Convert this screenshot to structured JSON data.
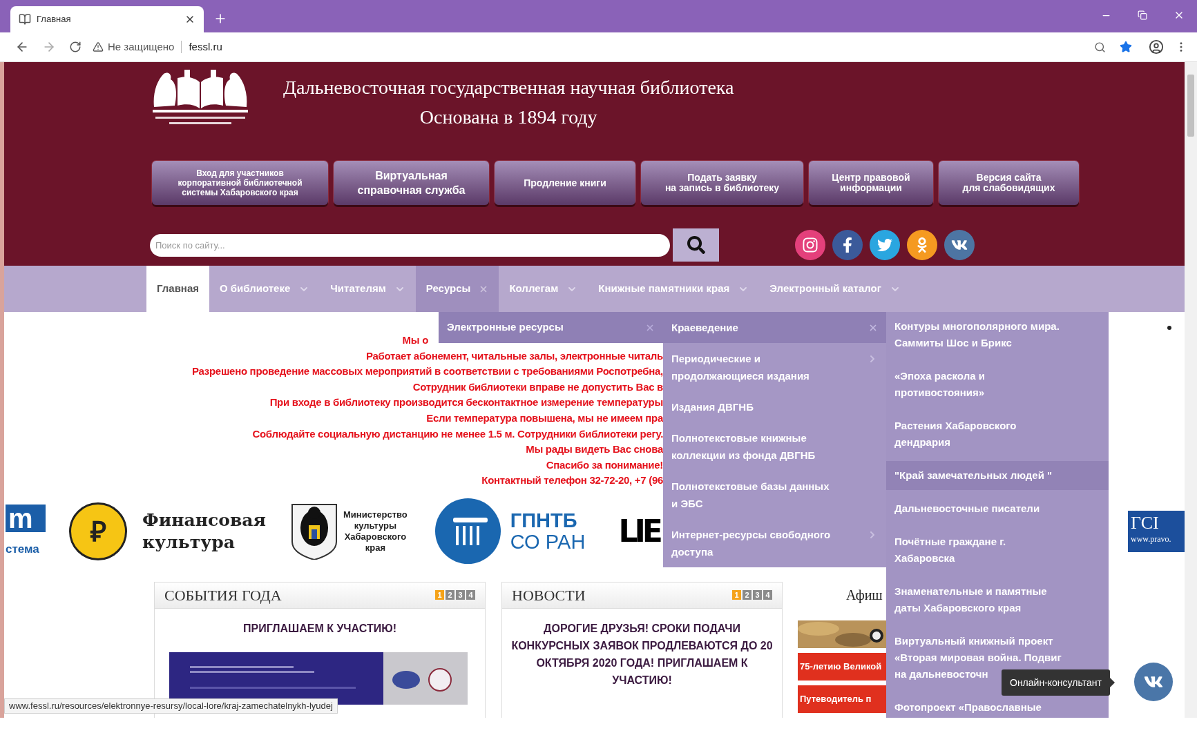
{
  "browser": {
    "tab_title": "Главная",
    "security": "Не защищено",
    "url": "fessl.ru"
  },
  "header": {
    "title": "Дальневосточная государственная научная библиотека",
    "subtitle": "Основана в 1894 году",
    "buttons": [
      [
        "Вход для участников",
        "корпоративной библиотечной",
        "системы Хабаровского края"
      ],
      [
        "Виртуальная",
        "справочная служба"
      ],
      [
        "Продление книги"
      ],
      [
        "Подать заявку",
        "на запись в библиотеку"
      ],
      [
        "Центр правовой",
        "информации"
      ],
      [
        "Версия сайта",
        "для слабовидящих"
      ]
    ]
  },
  "search": {
    "placeholder": "Поиск по сайту..."
  },
  "nav": [
    {
      "label": "Главная",
      "selected": true,
      "expanded": false,
      "has_submenu": false
    },
    {
      "label": "О библиотеке",
      "selected": false,
      "expanded": false,
      "has_submenu": true
    },
    {
      "label": "Читателям",
      "selected": false,
      "expanded": false,
      "has_submenu": true
    },
    {
      "label": "Ресурсы",
      "selected": false,
      "expanded": true,
      "has_submenu": true,
      "children": [
        {
          "label": "Электронные ресурсы",
          "expanded": true,
          "children": [
            {
              "label": "Краеведение",
              "expanded": true,
              "children": [
                {
                  "label": "Контуры многополярного мира. Саммиты Шос и Брикс",
                  "selected": false
                },
                {
                  "label": "«Эпоха раскола и противостояния»",
                  "selected": false
                },
                {
                  "label": "Растения Хабаровского дендрария",
                  "selected": false
                },
                {
                  "label": "\"Край замечательных людей \"",
                  "selected": true
                },
                {
                  "label": "Дальневосточные писатели",
                  "selected": false
                },
                {
                  "label": "Почётные граждане г. Хабаровска",
                  "selected": false
                },
                {
                  "label": "Знаменательные и памятные даты Хабаровского края",
                  "selected": false
                },
                {
                  "label": "Виртуальный книжный проект «Вторая мировая война. Подвиг на дальневосточн",
                  "selected": false
                },
                {
                  "label": "Фотопроект «Православные",
                  "selected": false
                }
              ]
            },
            {
              "label": "Периодические и продолжающиеся издания",
              "expanded": false,
              "has_submenu": true
            },
            {
              "label": "Издания ДВГНБ",
              "expanded": false,
              "has_submenu": false
            },
            {
              "label": "Полнотекстовые книжные коллекции из фонда ДВГНБ",
              "expanded": false,
              "has_submenu": false
            },
            {
              "label": "Полнотекстовые базы данных и ЭБС",
              "expanded": false,
              "has_submenu": false
            },
            {
              "label": "Интернет-ресурсы свободного доступа",
              "expanded": false,
              "has_submenu": true
            }
          ]
        }
      ]
    },
    {
      "label": "Коллегам",
      "selected": false,
      "expanded": false,
      "has_submenu": true
    },
    {
      "label": "Книжные памятники края",
      "selected": false,
      "expanded": false,
      "has_submenu": true
    },
    {
      "label": "Электронный каталог",
      "selected": false,
      "expanded": false,
      "has_submenu": true
    }
  ],
  "notice": [
    "Мы о",
    "Работает абонемент, читальные залы, электронные читаль",
    "Разрешено проведение массовых мероприятий в соответствии с требованиями Роспотребна,",
    "Сотрудник библиотеки вправе не допустить Вас в",
    "При входе в библиотеку производится бесконтактное измерение температуры",
    "Если температура повышена, мы не имеем пра",
    "Соблюдайте социальную дистанцию не менее 1.5 м. Сотрудники библиотеки регу.",
    "Мы рады видеть Вас снова",
    "Спасибо за понимание!",
    "Контактный телефон 32-72-20, +7 (96"
  ],
  "partners": [
    {
      "kind": "mark",
      "mark": "m",
      "lines": [
        "стема"
      ]
    },
    {
      "kind": "coin",
      "mark": "₽",
      "lines": [
        "Финансовая",
        "культура"
      ]
    },
    {
      "kind": "crest",
      "lines": [
        "Министерство",
        "культуры",
        "Хабаровского",
        "края"
      ]
    },
    {
      "kind": "column",
      "lines": [
        "ГПНТБ",
        "СО РАН"
      ]
    },
    {
      "kind": "block",
      "lines": [
        "LIE"
      ]
    },
    {
      "kind": "badge",
      "mark": "ГСІ",
      "lines": [
        "www.pravo."
      ]
    }
  ],
  "events": {
    "title": "СОБЫТИЯ ГОДА",
    "pages": [
      {
        "label": "1",
        "selected": true
      },
      {
        "label": "2",
        "selected": false
      },
      {
        "label": "3",
        "selected": false
      },
      {
        "label": "4",
        "selected": false
      }
    ],
    "headline": "ПРИГЛАШАЕМ К УЧАСТИЮ!"
  },
  "news": {
    "title": "НОВОСТИ",
    "pages": [
      {
        "label": "1",
        "selected": true
      },
      {
        "label": "2",
        "selected": false
      },
      {
        "label": "3",
        "selected": false
      },
      {
        "label": "4",
        "selected": false
      }
    ],
    "headline": "ДОРОГИЕ ДРУЗЬЯ! СРОКИ ПОДАЧИ КОНКУРСНЫХ ЗАЯВОК ПРОДЛЕВАЮТСЯ ДО 20 ОКТЯБРЯ 2020 ГОДА! ПРИГЛАШАЕМ К УЧАСТИЮ!"
  },
  "afisha": {
    "title": "Афиш",
    "banners": [
      "75-летию Великой",
      "Путеводитель п"
    ]
  },
  "status_url": "www.fessl.ru/resources/elektronnye-resursy/local-lore/kraj-zamechatelnykh-lyudej",
  "tooltip": "Онлайн-консультант"
}
